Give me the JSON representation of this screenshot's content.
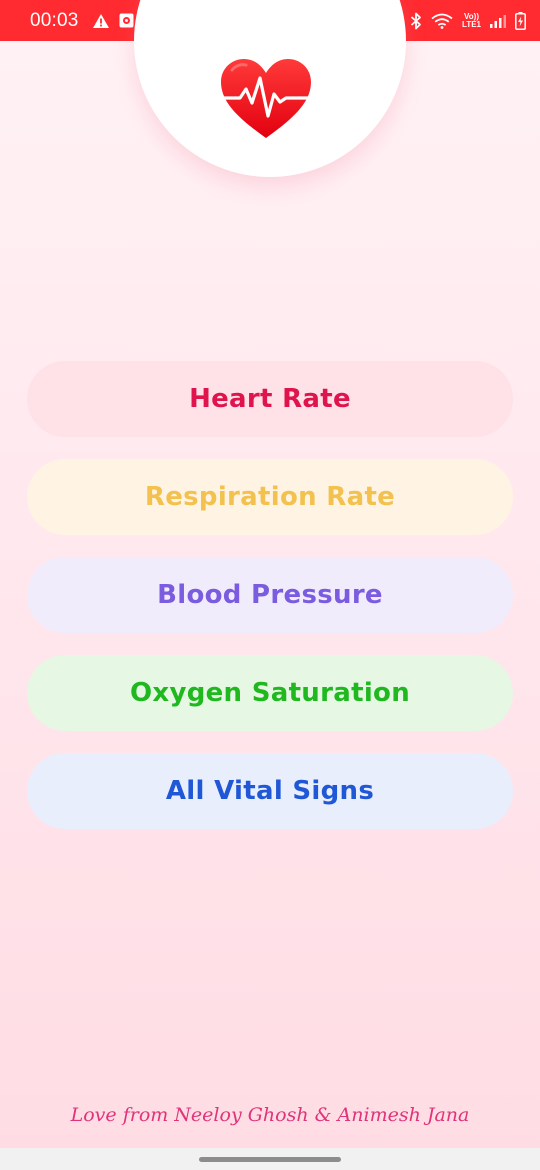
{
  "status_bar": {
    "time": "00:03",
    "icons_left": [
      "warning-icon",
      "notification-app-icon"
    ],
    "icons_right": [
      "vpn-key-icon",
      "alarm-icon",
      "bluetooth-icon",
      "wifi-icon",
      "volte-lte-icon",
      "signal-icon",
      "battery-icon"
    ],
    "lte_top": "Vo))",
    "lte_bottom": "LTE1",
    "background": "#ff2b30"
  },
  "logo": {
    "icon": "heart-pulse-icon",
    "color": "#ff1a25"
  },
  "menu": {
    "items": [
      {
        "label": "Heart Rate",
        "text_color": "#e0144c",
        "bg_color": "#ffe1e8"
      },
      {
        "label": "Respiration Rate",
        "text_color": "#f2c14e",
        "bg_color": "#fff3e3"
      },
      {
        "label": "Blood Pressure",
        "text_color": "#7b5ce0",
        "bg_color": "#f0ecfc"
      },
      {
        "label": "Oxygen Saturation",
        "text_color": "#1fb81f",
        "bg_color": "#e6f7e4"
      },
      {
        "label": "All Vital Signs",
        "text_color": "#1f57d6",
        "bg_color": "#e8eefc"
      }
    ]
  },
  "footer": {
    "text": "Love from Neeloy Ghosh & Animesh Jana",
    "color": "#e0337a"
  }
}
